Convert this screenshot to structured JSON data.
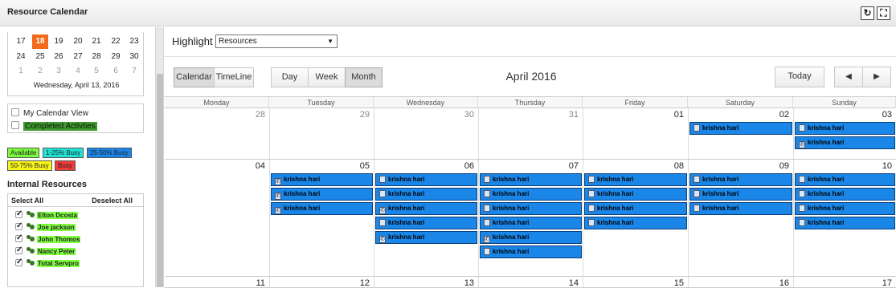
{
  "app": {
    "title": "Resource Calendar",
    "refresh_icon": "refresh-icon",
    "maximize_icon": "maximize-icon"
  },
  "mini_calendar": {
    "rows": [
      [
        "17",
        "18",
        "19",
        "20",
        "21",
        "22",
        "23"
      ],
      [
        "24",
        "25",
        "26",
        "27",
        "28",
        "29",
        "30"
      ],
      [
        "1",
        "2",
        "3",
        "4",
        "5",
        "6",
        "7"
      ]
    ],
    "today": "18",
    "selected_date_text": "Wednesday, April 13, 2016"
  },
  "options": {
    "my_calendar_view": "My Calendar View",
    "completed_activities": "Completed Activties"
  },
  "legend": [
    {
      "label": "Available",
      "color": "#7cfc3c"
    },
    {
      "label": "1-25% Busy",
      "color": "#1ee3d5"
    },
    {
      "label": "25-50% Busy",
      "color": "#1a86e8"
    },
    {
      "label": "50-75% Busy",
      "color": "#f8f51a"
    },
    {
      "label": "Busy",
      "color": "#f23b3b"
    }
  ],
  "internal_resources": {
    "title": "Internal Resources",
    "select_all": "Select All",
    "deselect_all": "Deselect All",
    "items": [
      "Elton Dcosta",
      "Joe jackson",
      "John Thomos",
      "Nancy Peter",
      "Total Servpro"
    ]
  },
  "highlight": {
    "label": "Highlight",
    "value": "Resources"
  },
  "toolbar": {
    "calendar": "Calendar",
    "timeline": "TimeLine",
    "day": "Day",
    "week": "Week",
    "month": "Month",
    "today": "Today",
    "prev_icon": "triangle-left-icon",
    "next_icon": "triangle-right-icon"
  },
  "calendar": {
    "month_title": "April 2016",
    "day_names": [
      "Monday",
      "Tuesday",
      "Wednesday",
      "Thursday",
      "Friday",
      "Saturday",
      "Sunday"
    ],
    "weeks": [
      {
        "dates": [
          "28",
          "29",
          "30",
          "31",
          "01",
          "02",
          "03"
        ],
        "dim": [
          true,
          true,
          true,
          true,
          false,
          false,
          false
        ]
      },
      {
        "dates": [
          "04",
          "05",
          "06",
          "07",
          "08",
          "09",
          "10"
        ],
        "dim": [
          false,
          false,
          false,
          false,
          false,
          false,
          false
        ]
      },
      {
        "dates": [
          "11",
          "12",
          "13",
          "14",
          "15",
          "16",
          "17"
        ],
        "dim": [
          false,
          false,
          false,
          false,
          false,
          false,
          false
        ]
      }
    ],
    "events": [
      {
        "week": 0,
        "day": 5,
        "slot": 0,
        "name": "krishna hari",
        "kind": "note"
      },
      {
        "week": 0,
        "day": 6,
        "slot": 0,
        "name": "krishna hari",
        "kind": "note"
      },
      {
        "week": 0,
        "day": 6,
        "slot": 1,
        "name": "krishna hari",
        "kind": "phone"
      },
      {
        "week": 1,
        "day": 1,
        "slot": 0,
        "name": "krishna hari",
        "kind": "phone"
      },
      {
        "week": 1,
        "day": 1,
        "slot": 1,
        "name": "krishna hari",
        "kind": "phone"
      },
      {
        "week": 1,
        "day": 1,
        "slot": 2,
        "name": "krishna hari",
        "kind": "phone"
      },
      {
        "week": 1,
        "day": 2,
        "slot": 0,
        "name": "krishna hari",
        "kind": "note"
      },
      {
        "week": 1,
        "day": 2,
        "slot": 1,
        "name": "krishna hari",
        "kind": "note"
      },
      {
        "week": 1,
        "day": 2,
        "slot": 2,
        "name": "krishna hari",
        "kind": "phone"
      },
      {
        "week": 1,
        "day": 2,
        "slot": 3,
        "name": "krishna hari",
        "kind": "note"
      },
      {
        "week": 1,
        "day": 2,
        "slot": 4,
        "name": "krishna hari",
        "kind": "phone"
      },
      {
        "week": 1,
        "day": 3,
        "slot": 0,
        "name": "krishna hari",
        "kind": "note"
      },
      {
        "week": 1,
        "day": 3,
        "slot": 1,
        "name": "krishna hari",
        "kind": "note"
      },
      {
        "week": 1,
        "day": 3,
        "slot": 2,
        "name": "krishna hari",
        "kind": "note"
      },
      {
        "week": 1,
        "day": 3,
        "slot": 3,
        "name": "krishna hari",
        "kind": "note"
      },
      {
        "week": 1,
        "day": 3,
        "slot": 4,
        "name": "krishna hari",
        "kind": "phone"
      },
      {
        "week": 1,
        "day": 3,
        "slot": 5,
        "name": "krishna hari",
        "kind": "note"
      },
      {
        "week": 1,
        "day": 4,
        "slot": 0,
        "name": "krishna hari",
        "kind": "note"
      },
      {
        "week": 1,
        "day": 4,
        "slot": 1,
        "name": "krishna hari",
        "kind": "note"
      },
      {
        "week": 1,
        "day": 4,
        "slot": 2,
        "name": "krishna hari",
        "kind": "note"
      },
      {
        "week": 1,
        "day": 4,
        "slot": 3,
        "name": "krishna hari",
        "kind": "note"
      },
      {
        "week": 1,
        "day": 5,
        "slot": 0,
        "name": "krishna hari",
        "kind": "note"
      },
      {
        "week": 1,
        "day": 5,
        "slot": 1,
        "name": "krishna hari",
        "kind": "note"
      },
      {
        "week": 1,
        "day": 5,
        "slot": 2,
        "name": "krishna hari",
        "kind": "note"
      },
      {
        "week": 1,
        "day": 6,
        "slot": 0,
        "name": "krishna hari",
        "kind": "note"
      },
      {
        "week": 1,
        "day": 6,
        "slot": 1,
        "name": "krishna hari",
        "kind": "note"
      },
      {
        "week": 1,
        "day": 6,
        "slot": 2,
        "name": "krishna hari",
        "kind": "note"
      },
      {
        "week": 1,
        "day": 6,
        "slot": 3,
        "name": "krishna hari",
        "kind": "note"
      }
    ]
  }
}
